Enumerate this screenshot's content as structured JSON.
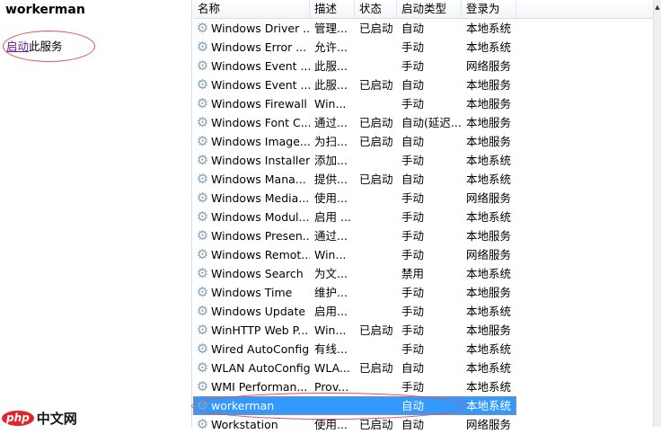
{
  "left_panel": {
    "service_title": "workerman",
    "start_link": "启动",
    "start_suffix": "此服务"
  },
  "watermark": {
    "logo": "php",
    "text": "中文网"
  },
  "columns": [
    "名称",
    "描述",
    "状态",
    "启动类型",
    "登录为"
  ],
  "rows": [
    [
      "Windows Driver ...",
      "管理...",
      "已启动",
      "自动",
      "本地系统"
    ],
    [
      "Windows Error ...",
      "允许...",
      "",
      "手动",
      "本地系统"
    ],
    [
      "Windows Event ...",
      "此服...",
      "",
      "手动",
      "网络服务"
    ],
    [
      "Windows Event ...",
      "此服...",
      "已启动",
      "自动",
      "本地服务"
    ],
    [
      "Windows Firewall",
      "Win...",
      "",
      "手动",
      "本地服务"
    ],
    [
      "Windows Font C...",
      "通过...",
      "已启动",
      "自动(延迟...",
      "本地服务"
    ],
    [
      "Windows Image...",
      "为扫...",
      "已启动",
      "自动",
      "本地服务"
    ],
    [
      "Windows Installer",
      "添加...",
      "",
      "手动",
      "本地系统"
    ],
    [
      "Windows Mana...",
      "提供...",
      "已启动",
      "自动",
      "本地系统"
    ],
    [
      "Windows Media...",
      "使用...",
      "",
      "手动",
      "网络服务"
    ],
    [
      "Windows Modul...",
      "启用 ...",
      "",
      "手动",
      "本地系统"
    ],
    [
      "Windows Presen...",
      "通过...",
      "",
      "手动",
      "本地服务"
    ],
    [
      "Windows Remot...",
      "Win...",
      "",
      "手动",
      "网络服务"
    ],
    [
      "Windows Search",
      "为文...",
      "",
      "禁用",
      "本地系统"
    ],
    [
      "Windows Time",
      "维护...",
      "",
      "手动",
      "本地服务"
    ],
    [
      "Windows Update",
      "启用...",
      "",
      "手动",
      "本地系统"
    ],
    [
      "WinHTTP Web P...",
      "Win...",
      "已启动",
      "手动",
      "本地服务"
    ],
    [
      "Wired AutoConfig",
      "有线...",
      "",
      "手动",
      "本地系统"
    ],
    [
      "WLAN AutoConfig",
      "WLA...",
      "已启动",
      "自动",
      "本地系统"
    ],
    [
      "WMI Performan...",
      "Prov...",
      "",
      "手动",
      "本地系统"
    ],
    [
      "workerman",
      "",
      "",
      "自动",
      "本地系统"
    ],
    [
      "Workstation",
      "使用...",
      "已启动",
      "自动",
      "网络服务"
    ]
  ],
  "selected_index": 20
}
